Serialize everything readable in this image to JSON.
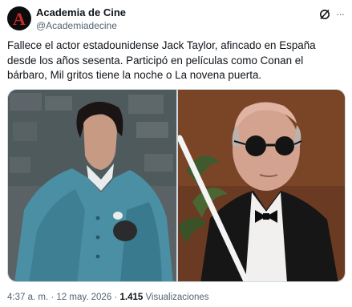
{
  "account": {
    "display_name": "Academia de Cine",
    "handle": "@Academiadecine",
    "avatar_letter": "A",
    "avatar_bg": "#0c0c0c",
    "avatar_letter_color": "#d02a2a"
  },
  "icons": {
    "grok": "grok-icon",
    "more": "more-horizontal-icon"
  },
  "more_glyph": "···",
  "tweet": {
    "text": "Fallece el actor estadounidense Jack Taylor, afincado en España desde los años sesenta. Participó en películas como Conan el bárbaro, Mil gritos tiene la noche o La novena puerta."
  },
  "meta": {
    "time": "4:37 a. m.",
    "separator": "·",
    "date": "12 may. 2026",
    "views_count": "1.415",
    "views_label": "Visualizaciones"
  },
  "colors": {
    "text": "#0f1419",
    "secondary": "#536471",
    "border": "#cfd9de"
  }
}
